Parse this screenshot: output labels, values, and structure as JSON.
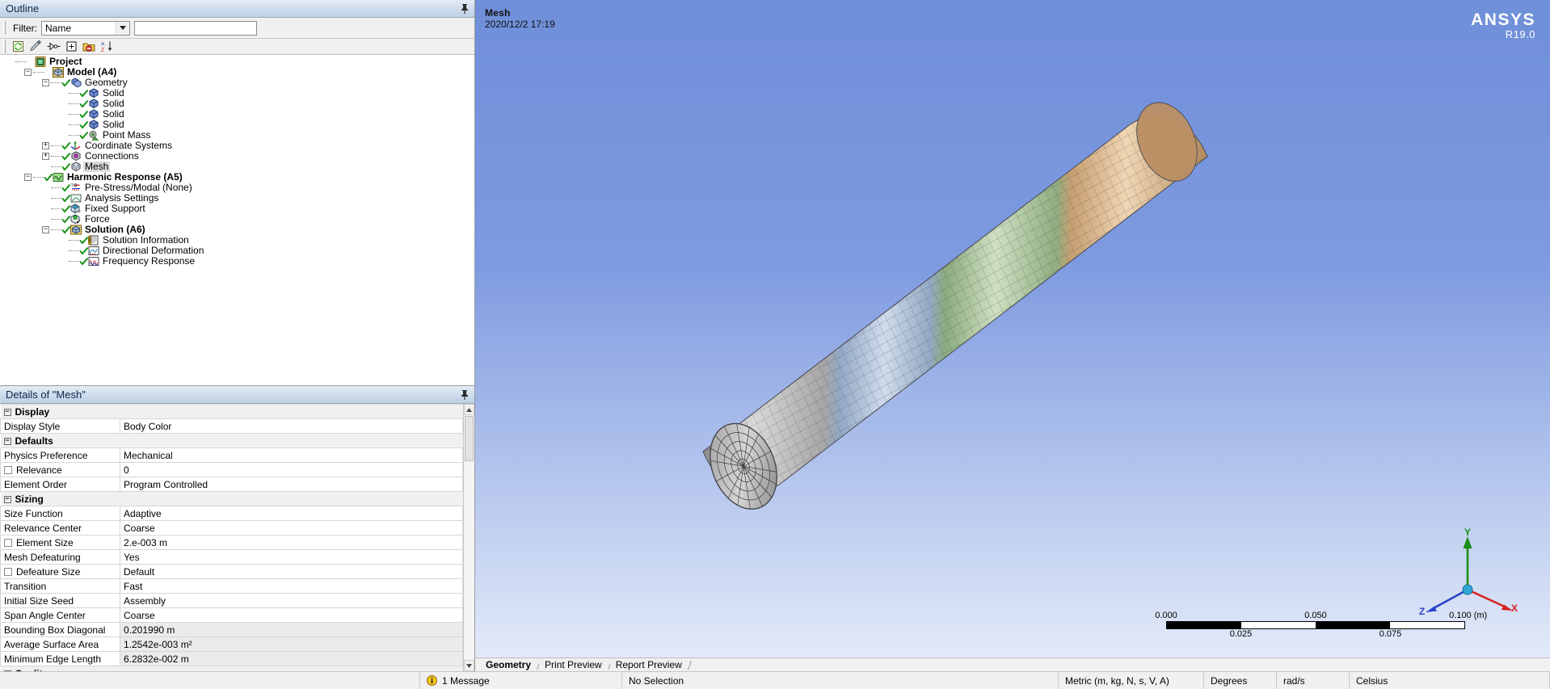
{
  "outline": {
    "panel_title": "Outline",
    "pin_icon": "pin-icon",
    "filter_label": "Filter:",
    "filter_mode": "Name",
    "filter_value": "",
    "filter_placeholder": "",
    "toolbar": [
      {
        "name": "refresh-tree-button",
        "glyph": "⟳"
      },
      {
        "name": "clear-generated-data-button",
        "glyph": "✎"
      },
      {
        "name": "show-dependencies-button",
        "glyph": "⊳"
      },
      {
        "name": "expand-all-button",
        "glyph": "+"
      },
      {
        "name": "collapse-folder-button",
        "glyph": "▤"
      },
      {
        "name": "sort-az-button",
        "glyph": "A↓"
      }
    ],
    "tree": [
      {
        "label": "Project",
        "depth": 0,
        "icon": "project-icon",
        "expander": "none",
        "status": "none",
        "bold": true,
        "selected": false
      },
      {
        "label": "Model (A4)",
        "depth": 1,
        "icon": "model-icon",
        "expander": "minus",
        "status": "none",
        "bold": true,
        "selected": false
      },
      {
        "label": "Geometry",
        "depth": 2,
        "icon": "geometry-icon",
        "expander": "minus",
        "status": "check",
        "bold": false,
        "selected": false
      },
      {
        "label": "Solid",
        "depth": 3,
        "icon": "solid-body-icon",
        "expander": "none",
        "status": "check",
        "bold": false,
        "selected": false
      },
      {
        "label": "Solid",
        "depth": 3,
        "icon": "solid-body-icon",
        "expander": "none",
        "status": "check",
        "bold": false,
        "selected": false
      },
      {
        "label": "Solid",
        "depth": 3,
        "icon": "solid-body-icon",
        "expander": "none",
        "status": "check",
        "bold": false,
        "selected": false
      },
      {
        "label": "Solid",
        "depth": 3,
        "icon": "solid-body-icon",
        "expander": "none",
        "status": "check",
        "bold": false,
        "selected": false
      },
      {
        "label": "Point Mass",
        "depth": 3,
        "icon": "point-mass-icon",
        "expander": "none",
        "status": "check",
        "bold": false,
        "selected": false
      },
      {
        "label": "Coordinate Systems",
        "depth": 2,
        "icon": "coordinate-systems-icon",
        "expander": "plus",
        "status": "check",
        "bold": false,
        "selected": false
      },
      {
        "label": "Connections",
        "depth": 2,
        "icon": "connections-icon",
        "expander": "plus",
        "status": "check",
        "bold": false,
        "selected": false
      },
      {
        "label": "Mesh",
        "depth": 2,
        "icon": "mesh-icon",
        "expander": "none",
        "status": "check",
        "bold": false,
        "selected": true
      },
      {
        "label": "Harmonic Response (A5)",
        "depth": 1,
        "icon": "harmonic-response-icon",
        "expander": "minus",
        "status": "check",
        "bold": true,
        "selected": false
      },
      {
        "label": "Pre-Stress/Modal (None)",
        "depth": 2,
        "icon": "pre-stress-icon",
        "expander": "none",
        "status": "check",
        "bold": false,
        "selected": false
      },
      {
        "label": "Analysis Settings",
        "depth": 2,
        "icon": "analysis-settings-icon",
        "expander": "none",
        "status": "check",
        "bold": false,
        "selected": false
      },
      {
        "label": "Fixed Support",
        "depth": 2,
        "icon": "fixed-support-icon",
        "expander": "none",
        "status": "check",
        "bold": false,
        "selected": false
      },
      {
        "label": "Force",
        "depth": 2,
        "icon": "force-icon",
        "expander": "none",
        "status": "check",
        "bold": false,
        "selected": false
      },
      {
        "label": "Solution (A6)",
        "depth": 2,
        "icon": "solution-icon",
        "expander": "minus",
        "status": "check",
        "bold": true,
        "selected": false
      },
      {
        "label": "Solution Information",
        "depth": 3,
        "icon": "solution-information-icon",
        "expander": "none",
        "status": "check",
        "bold": false,
        "selected": false
      },
      {
        "label": "Directional Deformation",
        "depth": 3,
        "icon": "directional-deformation-icon",
        "expander": "none",
        "status": "check",
        "bold": false,
        "selected": false
      },
      {
        "label": "Frequency Response",
        "depth": 3,
        "icon": "frequency-response-icon",
        "expander": "none",
        "status": "check",
        "bold": false,
        "selected": false
      }
    ]
  },
  "details": {
    "panel_title": "Details of \"Mesh\"",
    "pin_icon": "pin-icon",
    "rows": [
      {
        "type": "group",
        "name": "Display"
      },
      {
        "type": "row",
        "name": "Display Style",
        "value": "Body Color",
        "checkbox": false,
        "shaded": false
      },
      {
        "type": "group",
        "name": "Defaults"
      },
      {
        "type": "row",
        "name": "Physics Preference",
        "value": "Mechanical",
        "checkbox": false,
        "shaded": false
      },
      {
        "type": "row",
        "name": "Relevance",
        "value": "0",
        "checkbox": true,
        "shaded": false
      },
      {
        "type": "row",
        "name": "Element Order",
        "value": "Program Controlled",
        "checkbox": false,
        "shaded": false
      },
      {
        "type": "group",
        "name": "Sizing"
      },
      {
        "type": "row",
        "name": "Size Function",
        "value": "Adaptive",
        "checkbox": false,
        "shaded": false
      },
      {
        "type": "row",
        "name": "Relevance Center",
        "value": "Coarse",
        "checkbox": false,
        "shaded": false
      },
      {
        "type": "row",
        "name": "Element Size",
        "value": "2.e-003 m",
        "checkbox": true,
        "shaded": false
      },
      {
        "type": "row",
        "name": "Mesh Defeaturing",
        "value": "Yes",
        "checkbox": false,
        "shaded": false
      },
      {
        "type": "row",
        "name": "Defeature Size",
        "value": "Default",
        "checkbox": true,
        "shaded": false
      },
      {
        "type": "row",
        "name": "Transition",
        "value": "Fast",
        "checkbox": false,
        "shaded": false
      },
      {
        "type": "row",
        "name": "Initial Size Seed",
        "value": "Assembly",
        "checkbox": false,
        "shaded": false
      },
      {
        "type": "row",
        "name": "Span Angle Center",
        "value": "Coarse",
        "checkbox": false,
        "shaded": false
      },
      {
        "type": "row",
        "name": "Bounding Box Diagonal",
        "value": "0.201990 m",
        "checkbox": false,
        "shaded": true
      },
      {
        "type": "row",
        "name": "Average Surface Area",
        "value": "1.2542e-003 m²",
        "checkbox": false,
        "shaded": true
      },
      {
        "type": "row",
        "name": "Minimum Edge Length",
        "value": "6.2832e-002 m",
        "checkbox": false,
        "shaded": true
      },
      {
        "type": "group",
        "name": "Quality"
      }
    ]
  },
  "viewport": {
    "title": "Mesh",
    "date": "2020/12/2 17:19",
    "logo_name": "ANSYS",
    "logo_version": "R19.0",
    "scalebar": {
      "top_labels": [
        "0.000",
        "0.050",
        "0.100 (m)"
      ],
      "bottom_labels": [
        "0.025",
        "0.075"
      ],
      "segments": [
        "on",
        "off",
        "on",
        "off"
      ]
    },
    "triad": {
      "x_label": "X",
      "y_label": "Y",
      "z_label": "Z"
    },
    "tabs": [
      {
        "label": "Geometry",
        "active": true
      },
      {
        "label": "Print Preview",
        "active": false
      },
      {
        "label": "Report Preview",
        "active": false
      }
    ]
  },
  "statusbar": {
    "message_icon": "info-icon",
    "message": "1 Message",
    "selection": "No Selection",
    "unit_system": "Metric (m, kg, N, s, V, A)",
    "angle_unit": "Degrees",
    "rotation_unit": "rad/s",
    "temperature_unit": "Celsius"
  },
  "colors": {
    "panel_title_bg": "#cfdced",
    "viewport_top": "#6f8fd9",
    "viewport_bottom": "#e3eaf9",
    "accent_check": "#169416",
    "axis_x": "#d62121",
    "axis_y": "#1a8f1a",
    "axis_z": "#2a45c8"
  }
}
